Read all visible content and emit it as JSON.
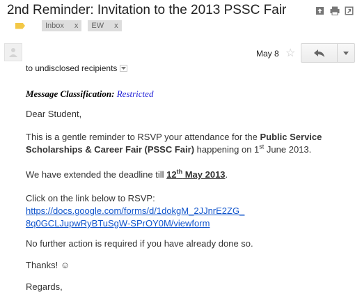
{
  "email": {
    "subject": "2nd Reminder: Invitation to the 2013 PSSC Fair",
    "labels": [
      {
        "name": "Inbox",
        "remove": "x"
      },
      {
        "name": "EW",
        "remove": "x"
      }
    ],
    "date": "May 8",
    "recipients": "to undisclosed recipients",
    "classification_label": "Message Classification:",
    "classification_value": "Restricted",
    "greeting": "Dear Student,",
    "p1_a": "This is a gentle reminder to RSVP your attendance for the ",
    "p1_b": "Public Service Scholarships & Career Fair (PSSC Fair)",
    "p1_c": " happening on 1",
    "p1_sup": "st",
    "p1_d": " June 2013.",
    "p2_a": "We have extended the deadline till ",
    "p2_day": "12",
    "p2_sup": "th",
    "p2_month": " May 2013",
    "p2_end": ".",
    "p3_intro": "Click on the link below to RSVP:",
    "link_line1": "https://docs.google.com/forms/d/1dokgM_2JJnrE2ZG_",
    "link_line2": "8q0GCLJupwRyBTuSgW-SPrOY0M/viewform",
    "p4": "No further action is required if you have already done so.",
    "thanks": "Thanks! ☺",
    "regards": "Regards,"
  },
  "icons": {
    "print": "print-icon",
    "new_window": "new-window-icon",
    "archive": "archive-icon",
    "reply": "reply-icon",
    "more": "dropdown-arrow-icon",
    "star": "star-icon"
  },
  "colors": {
    "important_marker": "#f3c847",
    "label_bg": "#dddddd",
    "link": "#1155cc",
    "classification_value": "#1a1ad6"
  }
}
